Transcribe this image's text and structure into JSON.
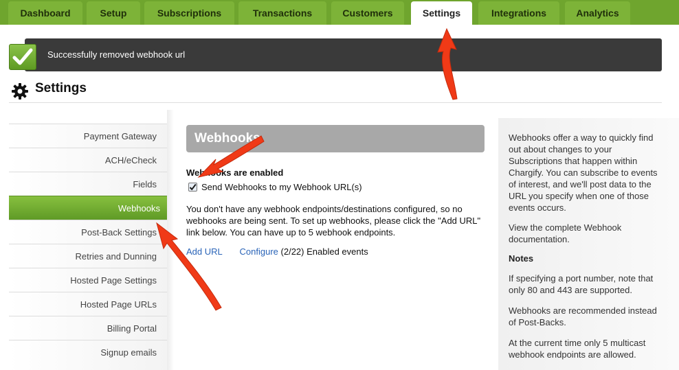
{
  "nav": {
    "tabs": [
      {
        "label": "Dashboard"
      },
      {
        "label": "Setup"
      },
      {
        "label": "Subscriptions"
      },
      {
        "label": "Transactions"
      },
      {
        "label": "Customers"
      },
      {
        "label": "Settings"
      },
      {
        "label": "Integrations"
      },
      {
        "label": "Analytics"
      }
    ],
    "active_tab": "Settings"
  },
  "flash": {
    "message": "Successfully removed webhook url"
  },
  "page": {
    "title": "Settings"
  },
  "sidebar": {
    "items": [
      {
        "label": "Payment Gateway"
      },
      {
        "label": "ACH/eCheck"
      },
      {
        "label": "Fields"
      },
      {
        "label": "Webhooks"
      },
      {
        "label": "Post-Back Settings"
      },
      {
        "label": "Retries and Dunning"
      },
      {
        "label": "Hosted Page Settings"
      },
      {
        "label": "Hosted Page URLs"
      },
      {
        "label": "Billing Portal"
      },
      {
        "label": "Signup emails"
      }
    ],
    "active_item": "Webhooks"
  },
  "main": {
    "header": "Webhooks",
    "enabled_title": "Webhooks are enabled",
    "checkbox_label": "Send Webhooks to my Webhook URL(s)",
    "checkbox_checked": true,
    "description": "You don't have any webhook endpoints/destinations configured, so no webhooks are being sent. To set up webhooks, please click the \"Add URL\" link below. You can have up to 5 webhook endpoints.",
    "add_url_label": "Add URL",
    "configure_label": "Configure",
    "events_count": "(2/22) Enabled events"
  },
  "help": {
    "intro": "Webhooks offer a way to quickly find out about changes to your Subscriptions that happen within Chargify. You can subscribe to events of interest, and we'll post data to the URL you specify when one of those events occurs.",
    "doc_link": "View the complete Webhook documentation.",
    "notes_title": "Notes",
    "note1": "If specifying a port number, note that only 80 and 443 are supported.",
    "note2": "Webhooks are recommended instead of Post-Backs.",
    "note3": "At the current time only 5 multicast webhook endpoints are allowed."
  },
  "colors": {
    "brand_green": "#6fa52e",
    "accent_arrow": "#f03a17",
    "link": "#2a64b8"
  }
}
